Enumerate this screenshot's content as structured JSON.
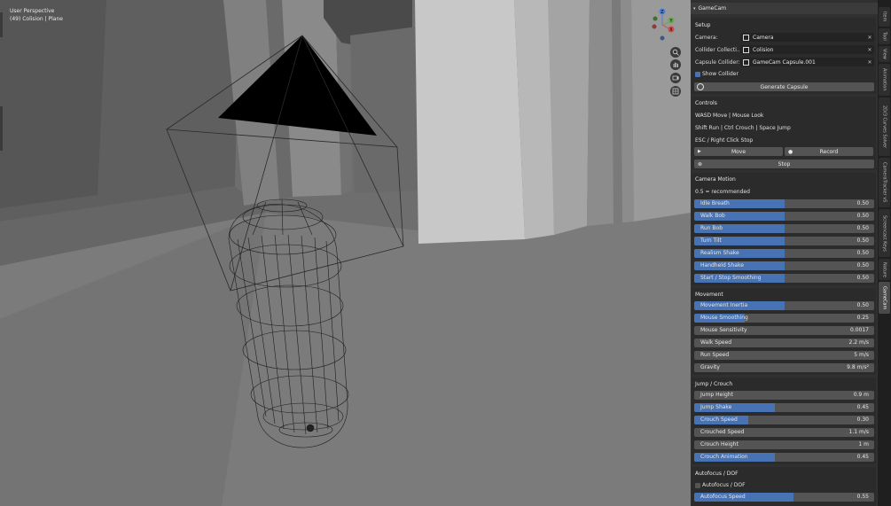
{
  "viewport": {
    "perspective_label": "User Perspective",
    "collection_label": "(49) Colision | Plane"
  },
  "gizmo": {
    "z_label": "Z",
    "y_label": "Y",
    "x_label": "X"
  },
  "colors": {
    "accent": "#4772b3",
    "panel": "#303030",
    "box": "#2b2b2b",
    "button": "#545454"
  },
  "panel": {
    "title": "GameCam",
    "setup": {
      "title": "Setup",
      "camera_label": "Camera:",
      "camera_value": "Camera",
      "collider_label": "Collider Collecti...",
      "collider_value": "Colision",
      "capsule_label": "Capsule Collider:",
      "capsule_value": "GameCam Capsule.001",
      "show_collider_label": "Show Collider",
      "show_collider_checked": true,
      "generate_label": "Generate Capsule"
    },
    "controls": {
      "title": "Controls",
      "line1": "WASD Move | Mouse Look",
      "line2": "Shift Run | Ctrl Crouch | Space Jump",
      "line3": "ESC / Right Click Stop",
      "move_label": "Move",
      "record_label": "Record",
      "stop_label": "Stop"
    },
    "camera_motion": {
      "title": "Camera Motion",
      "note": "0.5 = recommended",
      "sliders": [
        {
          "label": "Idle Breath",
          "value": "0.50",
          "fill": 0.5
        },
        {
          "label": "Walk Bob",
          "value": "0.50",
          "fill": 0.5
        },
        {
          "label": "Run Bob",
          "value": "0.50",
          "fill": 0.5
        },
        {
          "label": "Turn Tilt",
          "value": "0.50",
          "fill": 0.5
        },
        {
          "label": "Realism Shake",
          "value": "0.50",
          "fill": 0.5
        },
        {
          "label": "Handheld Shake",
          "value": "0.50",
          "fill": 0.5
        },
        {
          "label": "Start / Stop Smoothing",
          "value": "0.50",
          "fill": 0.5
        }
      ]
    },
    "movement": {
      "title": "Movement",
      "sliders": [
        {
          "label": "Movement Inertia",
          "value": "0.50",
          "fill": 0.5
        },
        {
          "label": "Mouse Smoothing",
          "value": "0.25",
          "fill": 0.28
        },
        {
          "label": "Mouse Sensitivity",
          "value": "0.0017",
          "fill": 0
        },
        {
          "label": "Walk Speed",
          "value": "2.2 m/s",
          "fill": 0
        },
        {
          "label": "Run Speed",
          "value": "5 m/s",
          "fill": 0
        },
        {
          "label": "Gravity",
          "value": "9.8 m/s²",
          "fill": 0
        }
      ]
    },
    "jump_crouch": {
      "title": "Jump / Crouch",
      "sliders": [
        {
          "label": "Jump Height",
          "value": "0.9 m",
          "fill": 0
        },
        {
          "label": "Jump Shake",
          "value": "0.45",
          "fill": 0.45
        },
        {
          "label": "Crouch Speed",
          "value": "0.30",
          "fill": 0.3
        },
        {
          "label": "Crouched Speed",
          "value": "1.1 m/s",
          "fill": 0
        },
        {
          "label": "Crouch Height",
          "value": "1 m",
          "fill": 0
        },
        {
          "label": "Crouch Animation",
          "value": "0.45",
          "fill": 0.45
        }
      ]
    },
    "autofocus": {
      "title": "Autofocus / DOF",
      "checkbox_label": "Autofocus / DOF",
      "checkbox_checked": false,
      "sliders": [
        {
          "label": "Autofocus Speed",
          "value": "0.55",
          "fill": 0.55
        }
      ]
    }
  },
  "tabs": [
    {
      "label": "Item",
      "active": false
    },
    {
      "label": "Tool",
      "active": false
    },
    {
      "label": "View",
      "active": false
    },
    {
      "label": "Animation",
      "active": false
    },
    {
      "label": "2D/3 Curves Solver",
      "active": false
    },
    {
      "label": "CameraTracker v5",
      "active": false
    },
    {
      "label": "Screencast Keys",
      "active": false
    },
    {
      "label": "Nature",
      "active": false
    },
    {
      "label": "GameCam",
      "active": true
    }
  ]
}
